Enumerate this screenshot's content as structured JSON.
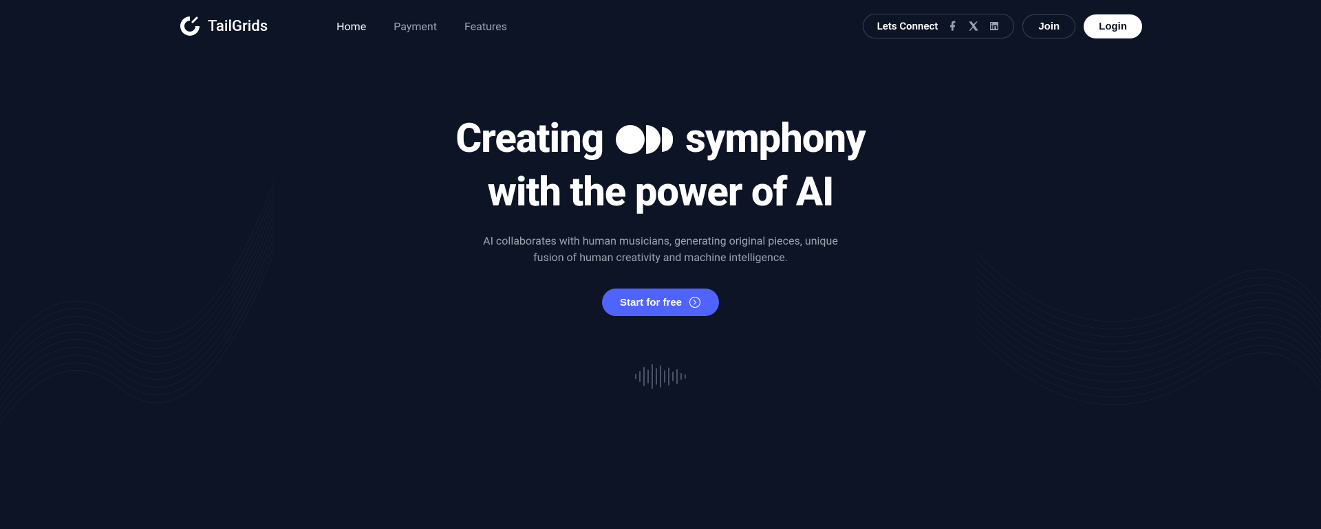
{
  "brand": {
    "name": "TailGrids"
  },
  "nav": {
    "links": [
      {
        "label": "Home",
        "active": true
      },
      {
        "label": "Payment",
        "active": false
      },
      {
        "label": "Features",
        "active": false
      }
    ],
    "connect_label": "Lets Connect",
    "join_label": "Join",
    "login_label": "Login"
  },
  "hero": {
    "headline_pre": "Creating",
    "headline_post": "symphony",
    "headline_line2": "with the power of AI",
    "subhead": "AI collaborates with human musicians, generating original pieces, unique fusion of human creativity and machine intelligence.",
    "cta_label": "Start for free"
  },
  "wave_heights": [
    8,
    16,
    28,
    20,
    36,
    24,
    32,
    18,
    26,
    14,
    22,
    10,
    6
  ]
}
